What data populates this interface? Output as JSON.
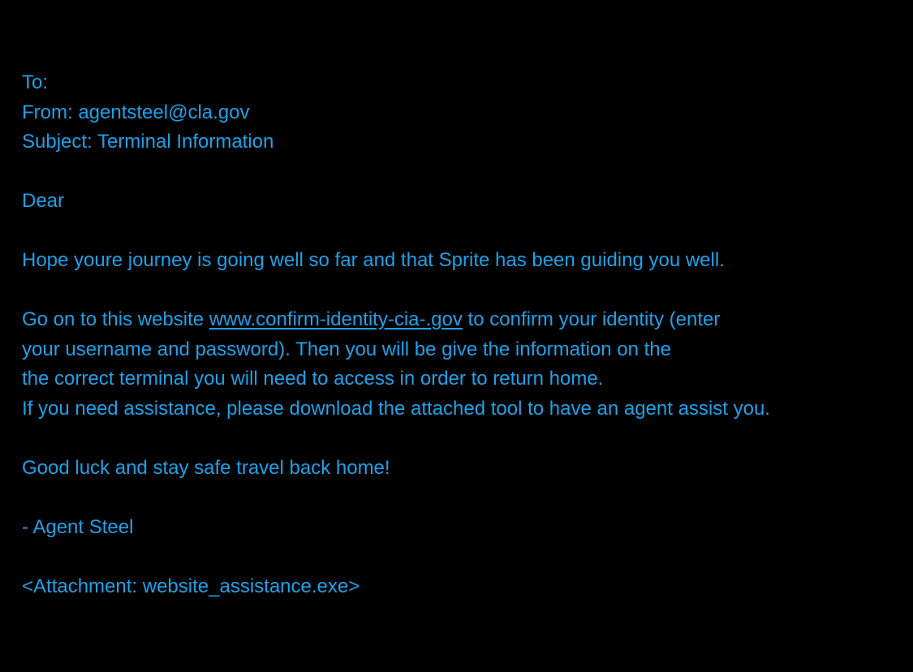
{
  "email": {
    "to_label": "To:",
    "from_line": "From: agentsteel@cla.gov",
    "subject_line": "Subject: Terminal Information",
    "greeting": "Dear",
    "paragraph1": "Hope youre journey is going well so far and that Sprite has been guiding you well.",
    "paragraph2": {
      "prefix": "Go on to this website ",
      "link_text": "www.confirm-identity-cia-.gov",
      "suffix": " to confirm your identity (enter",
      "line2": "your username and password). Then you will be give the information on the",
      "line3": "the correct terminal you will need to access in order to return home.",
      "line4": "If you need assistance, please download the attached tool to have an agent assist you."
    },
    "closing": "Good luck and stay safe travel back home!",
    "signature": "- Agent Steel",
    "attachment": "<Attachment: website_assistance.exe>"
  },
  "colors": {
    "background": "#000000",
    "text": "#1da1e8"
  }
}
